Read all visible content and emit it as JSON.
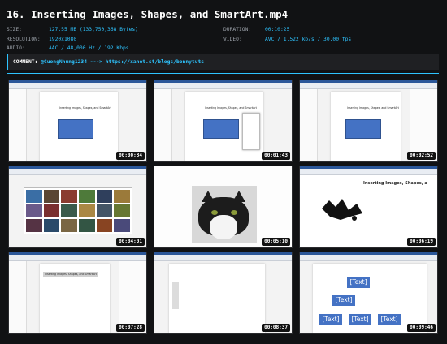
{
  "header": {
    "title": "16. Inserting Images, Shapes, and SmartArt.mp4"
  },
  "meta_left": [
    {
      "key": "SIZE:",
      "value": "127.55 MB (133,750,368 Bytes)"
    },
    {
      "key": "RESOLUTION:",
      "value": "1920x1080"
    },
    {
      "key": "AUDIO:",
      "value": "AAC / 48,000 Hz / 192 Kbps"
    }
  ],
  "meta_right": [
    {
      "key": "DURATION:",
      "value": "00:10:25"
    },
    {
      "key": "VIDEO:",
      "value": "AVC / 1,522 kb/s / 30.00 fps"
    }
  ],
  "comment": {
    "label": "COMMENT:",
    "text": "@CuongNhung1234 ---> https://xanet.st/blogs/bonnytuts"
  },
  "doc": {
    "title": "Inserting Images, Shapes, and SmartArt",
    "big_title": "Inserting Images, Shapes, a"
  },
  "smartart": {
    "text": "[Text]"
  },
  "thumbnails": [
    {
      "time": "00:00:34"
    },
    {
      "time": "00:01:43"
    },
    {
      "time": "00:02:52"
    },
    {
      "time": "00:04:01"
    },
    {
      "time": "00:05:10"
    },
    {
      "time": "00:06:19"
    },
    {
      "time": "00:07:28"
    },
    {
      "time": "00:08:37"
    },
    {
      "time": "00:09:46"
    }
  ],
  "colors": {
    "accent": "#2ec4ff",
    "background": "#111214",
    "shape_fill": "#4472c4",
    "word_blue": "#2b579a"
  }
}
